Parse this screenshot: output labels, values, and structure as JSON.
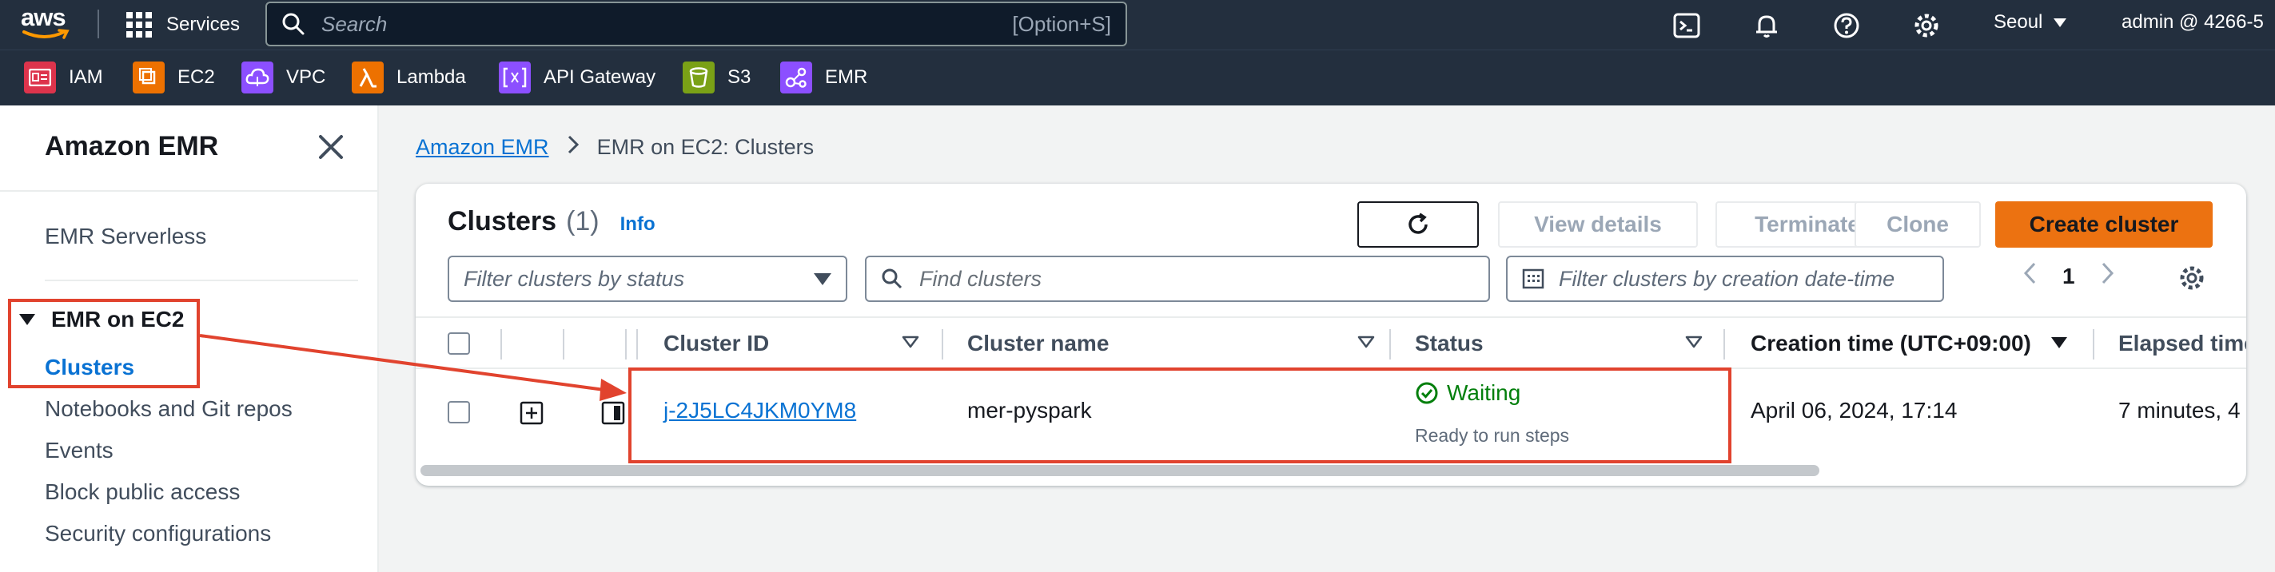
{
  "topbar": {
    "logo_text": "aws",
    "services_label": "Services",
    "search_placeholder": "Search",
    "search_shortcut": "[Option+S]",
    "region": "Seoul",
    "account": "admin @ 4266-5"
  },
  "favorites": [
    {
      "label": "IAM",
      "color": "#dd344c"
    },
    {
      "label": "EC2",
      "color": "#ed7100"
    },
    {
      "label": "VPC",
      "color": "#8c4fff"
    },
    {
      "label": "Lambda",
      "color": "#ed7100"
    },
    {
      "label": "API Gateway",
      "color": "#8c4fff"
    },
    {
      "label": "S3",
      "color": "#7aa116"
    },
    {
      "label": "EMR",
      "color": "#8c4fff"
    }
  ],
  "sidebar": {
    "title": "Amazon EMR",
    "serverless": "EMR Serverless",
    "section": "EMR on EC2",
    "items": [
      "Clusters",
      "Notebooks and Git repos",
      "Events",
      "Block public access",
      "Security configurations"
    ]
  },
  "breadcrumb": {
    "root": "Amazon EMR",
    "current": "EMR on EC2: Clusters"
  },
  "panel": {
    "title": "Clusters",
    "count": "(1)",
    "info": "Info",
    "buttons": {
      "view_details": "View details",
      "terminate": "Terminate",
      "clone": "Clone",
      "create": "Create cluster"
    },
    "filters": {
      "status_placeholder": "Filter clusters by status",
      "find_placeholder": "Find clusters",
      "date_placeholder": "Filter clusters by creation date-time"
    },
    "page": "1"
  },
  "table": {
    "columns": [
      "Cluster ID",
      "Cluster name",
      "Status",
      "Creation time (UTC+09:00)",
      "Elapsed time"
    ],
    "rows": [
      {
        "cluster_id": "j-2J5LC4JKM0YM8",
        "cluster_name": "mer-pyspark",
        "status": "Waiting",
        "status_detail": "Ready to run steps",
        "creation_time": "April 06, 2024, 17:14",
        "elapsed": "7 minutes, 4"
      }
    ]
  },
  "colors": {
    "nav_bg": "#232f3e",
    "link": "#0972d3",
    "primary": "#ec7211",
    "success": "#037f0c",
    "annotation": "#e1432e"
  }
}
